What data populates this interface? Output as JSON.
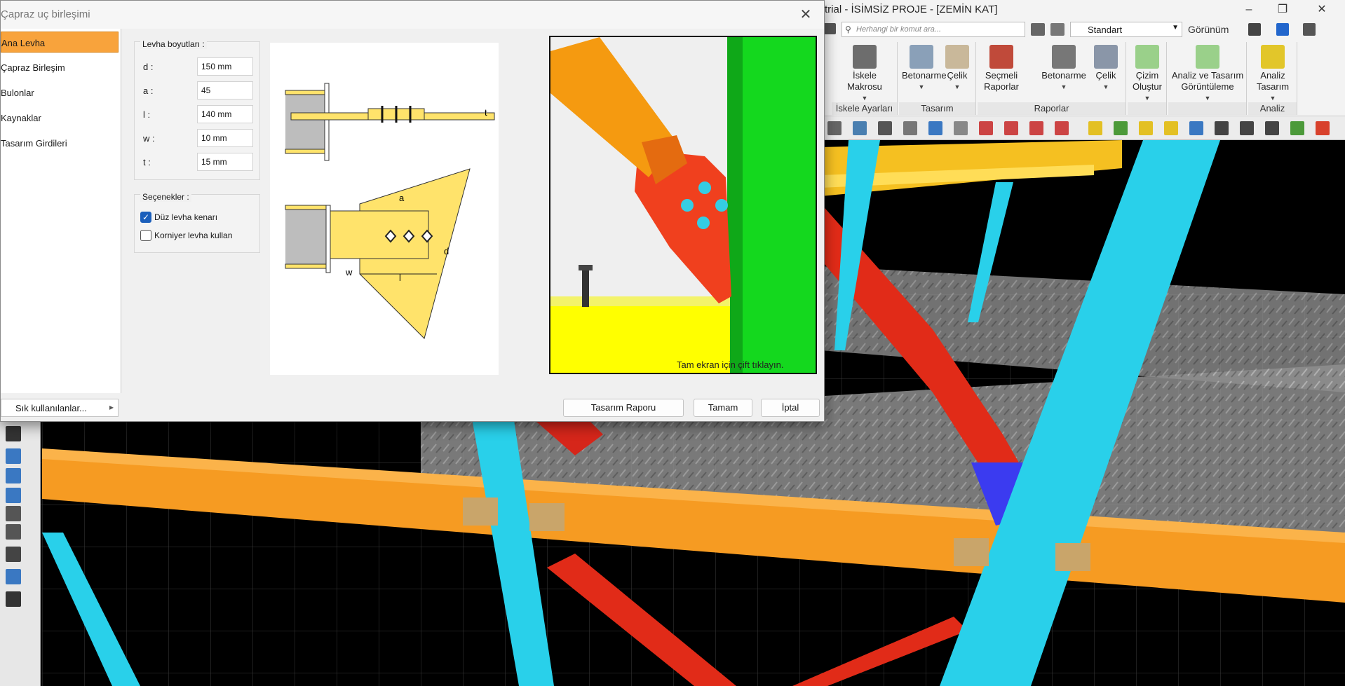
{
  "app": {
    "title": "trial - İSİMSİZ PROJE - [ZEMİN KAT]",
    "minimize_icon": "minimize-icon",
    "maximize_icon": "restore-icon",
    "close_icon": "close-icon"
  },
  "ribbon": {
    "search_placeholder": "Herhangi bir komut ara...",
    "style_value": "Standart",
    "view_label": "Görünüm",
    "panels": [
      {
        "caption": "İskele Ayarları",
        "buttons": [
          {
            "label": "İskele Makrosu"
          }
        ]
      },
      {
        "caption": "Tasarım",
        "buttons": [
          {
            "label": "Betonarme"
          },
          {
            "label": "Çelik"
          }
        ]
      },
      {
        "caption": "Raporlar",
        "buttons": [
          {
            "label": "Seçmeli Raporlar"
          },
          {
            "label": "Betonarme"
          },
          {
            "label": "Çelik"
          }
        ]
      },
      {
        "caption": "",
        "buttons": [
          {
            "label": "Çizim Oluştur"
          }
        ]
      },
      {
        "caption": "",
        "buttons": [
          {
            "label": "Analiz ve Tasarım Görüntüleme"
          }
        ]
      },
      {
        "caption": "Analiz",
        "buttons": [
          {
            "label": "Analiz Tasarım"
          }
        ]
      }
    ]
  },
  "dialog": {
    "title": "Çapraz uç birleşimi",
    "close_icon": "close-icon",
    "nav_items": [
      {
        "label": "Ana Levha",
        "active": true
      },
      {
        "label": "Çapraz Birleşim",
        "active": false
      },
      {
        "label": "Bulonlar",
        "active": false
      },
      {
        "label": "Kaynaklar",
        "active": false
      },
      {
        "label": "Tasarım Girdileri",
        "active": false
      }
    ],
    "favorites_label": "Sık kullanılanlar...",
    "plate_group": {
      "title": "Levha boyutları :",
      "fields": [
        {
          "label": "d :",
          "value": "150 mm"
        },
        {
          "label": "a :",
          "value": "45"
        },
        {
          "label": "l :",
          "value": "140 mm"
        },
        {
          "label": "w :",
          "value": "10 mm"
        },
        {
          "label": "t :",
          "value": "15 mm"
        }
      ]
    },
    "options_group": {
      "title": "Seçenekler :",
      "options": [
        {
          "label": "Düz levha kenarı",
          "checked": true
        },
        {
          "label": "Korniyer levha kullan",
          "checked": false
        }
      ]
    },
    "diagram_labels": {
      "t": "t",
      "a": "a",
      "d": "d",
      "w": "w",
      "l": "l"
    },
    "preview_hint": "Tam ekran için çift tıklayın.",
    "buttons": {
      "report": "Tasarım Raporu",
      "ok": "Tamam",
      "cancel": "İptal"
    }
  }
}
